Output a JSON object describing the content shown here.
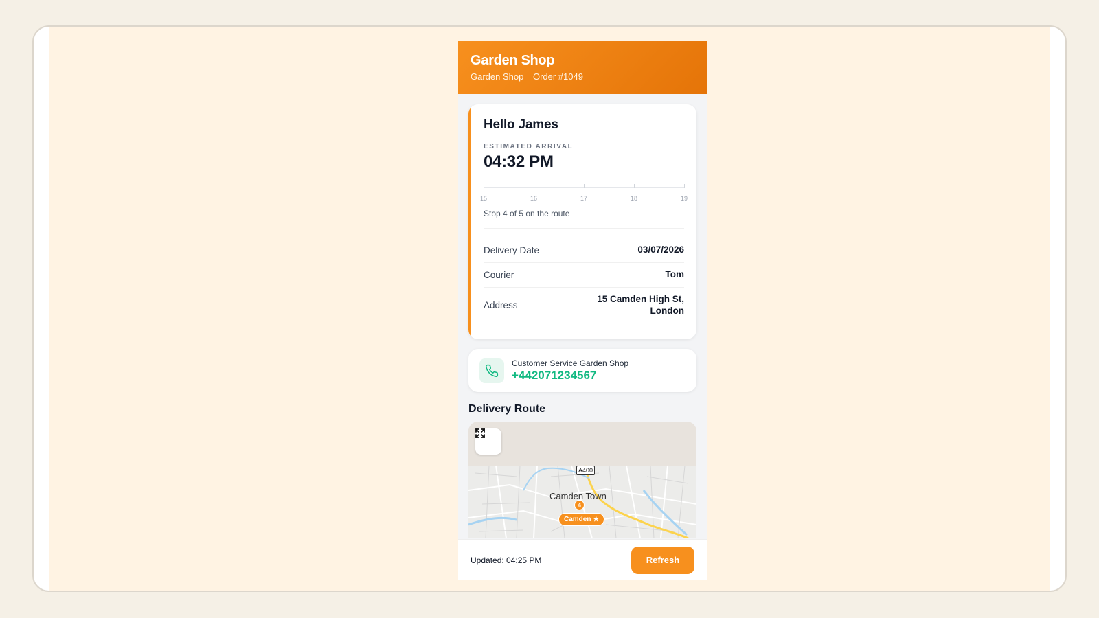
{
  "header": {
    "title": "Garden Shop",
    "shop_name": "Garden Shop",
    "order": "Order #1049"
  },
  "status_card": {
    "greeting": "Hello James",
    "eta_label": "ESTIMATED ARRIVAL",
    "eta_time": "04:32 PM",
    "timeline_ticks": [
      "15",
      "16",
      "17",
      "18",
      "19"
    ],
    "stop_text": "Stop 4 of 5 on the route",
    "details": [
      {
        "label": "Delivery Date",
        "value": "03/07/2026"
      },
      {
        "label": "Courier",
        "value": "Tom"
      },
      {
        "label": "Address",
        "value": "15 Camden High St, London"
      }
    ]
  },
  "contact": {
    "label": "Customer Service Garden Shop",
    "phone": "+442071234567"
  },
  "route": {
    "title": "Delivery Route",
    "map_town": "Camden Town",
    "road_shield": "A400",
    "stop_marker": "4",
    "destination_marker": "Camden ★"
  },
  "footer": {
    "updated": "Updated: 04:25 PM",
    "refresh_label": "Refresh"
  },
  "colors": {
    "accent": "#f7901e",
    "phone_green": "#10b981"
  }
}
